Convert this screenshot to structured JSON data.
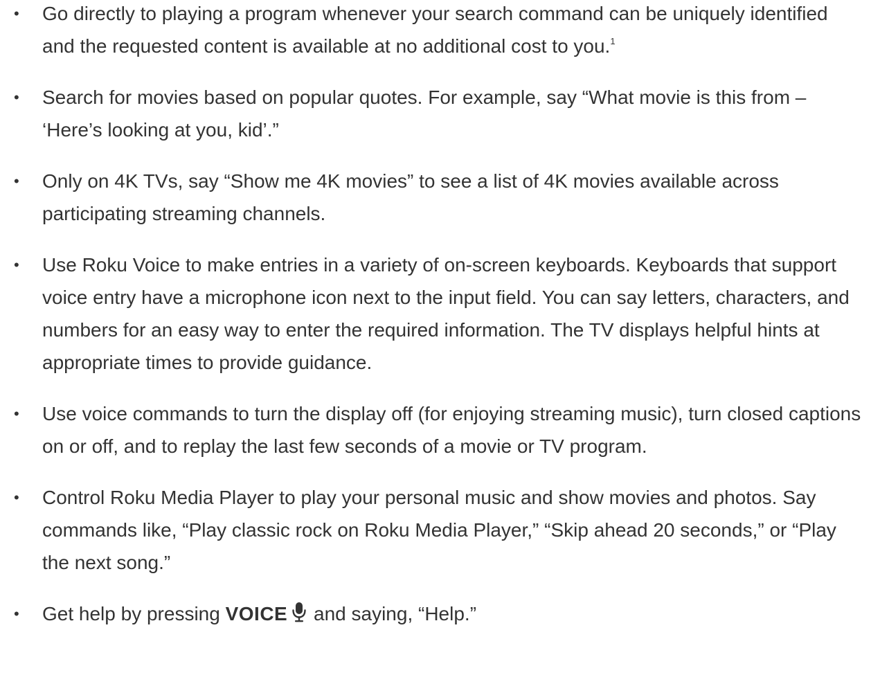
{
  "bullets": [
    {
      "text": "Go directly to playing a program whenever your search command can be uniquely identified and the requested content is available at no additional cost to you.",
      "footnote": "1"
    },
    {
      "text": "Search for movies based on popular quotes. For example, say “What movie is this from – ‘Here’s looking at you, kid’.”"
    },
    {
      "text": "Only on 4K TVs, say “Show me 4K movies” to see a list of 4K movies available across participating streaming channels."
    },
    {
      "text": "Use Roku Voice to make entries in a variety of on-screen keyboards. Keyboards that support voice entry have a microphone icon next to the input field. You can say letters, characters, and numbers for an easy way to enter the required information. The TV displays helpful hints at appropriate times to provide guidance."
    },
    {
      "text": "Use voice commands to turn the display off (for enjoying streaming music), turn closed captions on or off, and to replay the last few seconds of a movie or TV program."
    },
    {
      "text": "Control Roku Media Player to play your personal music and show movies and photos. Say commands like, “Play classic rock on Roku Media Player,” “Skip ahead 20 seconds,” or “Play the next song.”"
    },
    {
      "text_before": "Get help by pressing ",
      "key_label": "VOICE",
      "key_icon": "microphone-icon",
      "text_after": " and saying, “Help.”"
    }
  ],
  "bullet_glyph": "•",
  "colors": {
    "text": "#333333",
    "background": "#ffffff"
  }
}
